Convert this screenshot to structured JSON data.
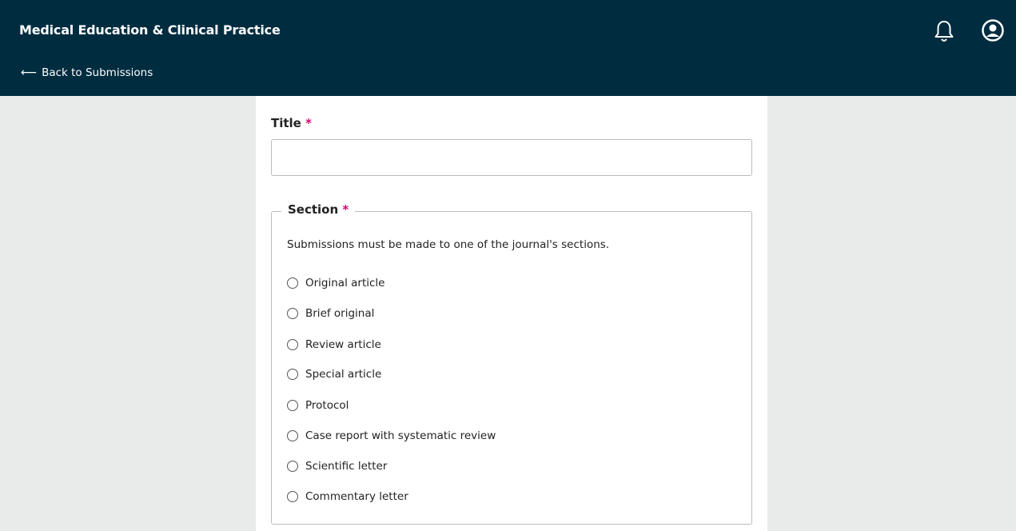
{
  "header": {
    "app_title": "Medical Education & Clinical Practice",
    "back_link": "Back to Submissions",
    "back_arrow": "⟵",
    "notification_icon": "bell-icon",
    "user_icon": "user-circle-icon"
  },
  "form": {
    "title_label": "Title",
    "required_mark": "*",
    "title_value": "",
    "section_legend": "Section",
    "section_description": "Submissions must be made to one of the journal's sections.",
    "sections": [
      "Original article",
      "Brief original",
      "Review article",
      "Special article",
      "Protocol",
      "Case report with systematic review",
      "Scientific letter",
      "Commentary letter"
    ]
  },
  "colors": {
    "header_bg": "#002c40",
    "required": "#d00a6c",
    "page_bg": "#e9ebeb"
  }
}
